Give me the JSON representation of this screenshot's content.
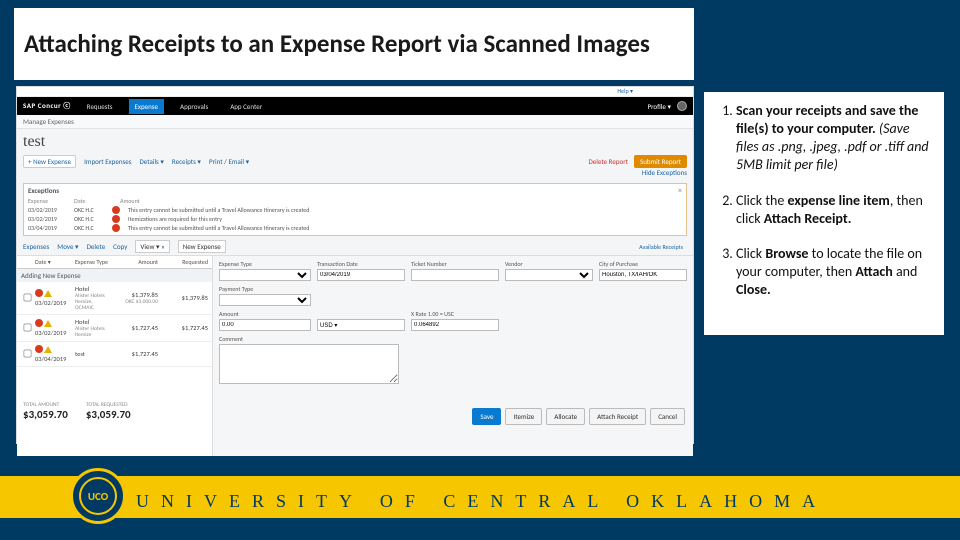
{
  "title": "Attaching Receipts to an Expense Report via Scanned Images",
  "instructions": {
    "s1a": "Scan your receipts and save the file(s) to your computer. ",
    "s1b": "(Save files as .png, .jpeg, .pdf or .tiff and 5MB limit per file)",
    "s2a": "Click the ",
    "s2b": "expense line item",
    "s2c": ", then click ",
    "s2d": "Attach Receipt.",
    "s3a": "Click ",
    "s3b": "Browse",
    "s3c": " to locate the file on your computer, then ",
    "s3d": "Attach",
    "s3e": " and ",
    "s3f": "Close."
  },
  "concur": {
    "help": "Help ▾",
    "logo": "SAP Concur ⓒ",
    "nav": {
      "requests": "Requests",
      "expense": "Expense",
      "approvals": "Approvals",
      "appcenter": "App Center"
    },
    "profile": "Profile ▾",
    "sub": "Manage Expenses",
    "report_name": "test",
    "actions": {
      "new": "+ New Expense",
      "import": "Import Expenses",
      "details": "Details ▾",
      "receipts": "Receipts ▾",
      "print": "Print / Email ▾",
      "delete": "Delete Report",
      "submit": "Submit Report",
      "hide": "Hide Exceptions"
    },
    "exc": {
      "head": "Exceptions",
      "h_expense": "Expense",
      "h_date": "Date",
      "h_amount": "Amount",
      "rows": [
        {
          "date": "03/02/2019",
          "code": "OKC H.C",
          "msg": "This entry cannot be submitted until a Travel Allowance Itinerary is created"
        },
        {
          "date": "03/02/2019",
          "code": "OKC H.C",
          "msg": "Itemizations are required for this entry"
        },
        {
          "date": "03/04/2019",
          "code": "OKC H.C",
          "msg": "This entry cannot be submitted until a Travel Allowance Itinerary is created"
        }
      ]
    },
    "exptb": {
      "expenses": "Expenses",
      "move": "Move ▾",
      "delete": "Delete",
      "copy": "Copy",
      "view": "View ▾ «",
      "newexp": "New Expense",
      "avail": "Available Receipts"
    },
    "thead": {
      "date": "Date ▾",
      "type": "Expense Type",
      "amount": "Amount",
      "requested": "Requested"
    },
    "adding": "Adding New Expense",
    "rows": [
      {
        "date": "03/02/2019",
        "type": "Hotel",
        "sub": "Alister Hotels  Itemize, OCMAIC",
        "amount": "$1,379.85",
        "req": "$1,379.85",
        "city": "OKC $3,000.00",
        "err": true,
        "warn": true
      },
      {
        "date": "03/02/2019",
        "type": "Hotel",
        "sub": "Alister Hotels  Itemize",
        "amount": "$1,727.45",
        "req": "$1,727.45",
        "err": true,
        "warn": true
      },
      {
        "date": "03/04/2019",
        "type": "test",
        "sub": "",
        "amount": "$1,727.45",
        "req": "",
        "err": true,
        "warn": true
      }
    ],
    "form": {
      "expense_type": "Expense Type",
      "trans_date": "Transaction Date",
      "trans_date_val": "03/04/2019",
      "ticket": "Ticket Number",
      "vendor": "Vendor",
      "city": "City of Purchase",
      "city_val": "Houston, TX/IAH/OK",
      "payment": "Payment Type",
      "amount_lbl": "Amount",
      "amount_val": "0.00",
      "currency": "X Rate 1.00 = USC",
      "currency2": "USD ▾",
      "buss_amt": "0.064892",
      "comment": "Comment"
    },
    "totals": {
      "lbl1": "TOTAL AMOUNT",
      "val1": "$3,059.70",
      "lbl2": "TOTAL REQUESTED",
      "val2": "$3,059.70"
    },
    "fbtn": {
      "save": "Save",
      "itemize": "Itemize",
      "allocate": "Allocate",
      "attach": "Attach Receipt",
      "cancel": "Cancel"
    }
  },
  "footer": {
    "uco": "UNIVERSITY OF CENTRAL OKLAHOMA",
    "seal": "UCO"
  }
}
